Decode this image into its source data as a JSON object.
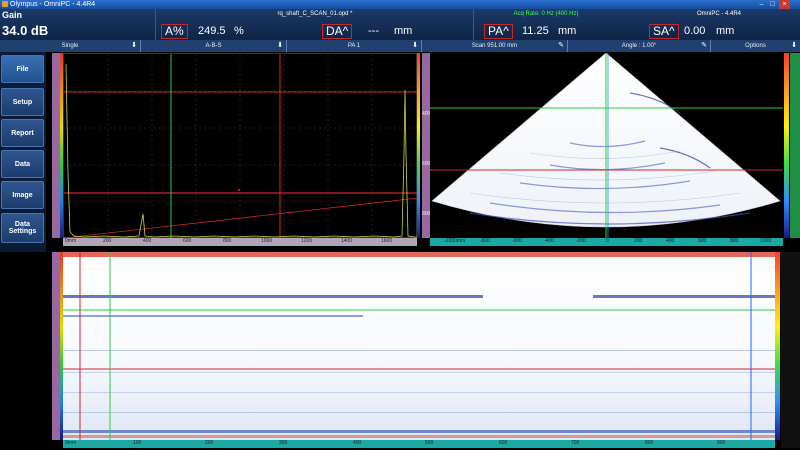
{
  "window": {
    "title": "Olympus - OmniPC - 4.4R4"
  },
  "header": {
    "gain_label": "Gain",
    "gain_value": "34.0 dB",
    "file_name": "rq_shaft_C_SCAN_01.opd *",
    "acq_rate": "Acq Rate: 0 Hz (400 Hz)",
    "app_version": "OmniPC - 4.4R4",
    "readings": [
      {
        "label": "A%",
        "value": "249.5",
        "unit": "%"
      },
      {
        "label": "DA^",
        "value": "---",
        "unit": "mm"
      },
      {
        "label": "PA^",
        "value": "11.25",
        "unit": "mm"
      },
      {
        "label": "SA^",
        "value": "0.00",
        "unit": "mm"
      }
    ]
  },
  "toolbar": {
    "segments": [
      "Single",
      "A-B-S",
      "PA 1",
      "Scan 951.00 mm",
      "Angle : 1.00°",
      "Options"
    ]
  },
  "nav": {
    "items": [
      "File",
      "Setup",
      "Report",
      "Data",
      "Image",
      "Data Settings"
    ]
  },
  "ascan": {
    "x_ticks": [
      "0mm",
      "200",
      "400",
      "600",
      "800",
      "1000",
      "1200",
      "1400",
      "1600"
    ]
  },
  "sscan": {
    "x_ticks": [
      "-1000mm",
      "-800",
      "-600",
      "-400",
      "-200",
      "0",
      "200",
      "400",
      "600",
      "800",
      "1000"
    ],
    "y_ticks": [
      "400",
      "600",
      "800",
      "1000"
    ]
  },
  "cscan": {
    "x_ticks": [
      "0mm",
      "100",
      "200",
      "300",
      "400",
      "500",
      "600",
      "700",
      "800",
      "900"
    ]
  },
  "colors": {
    "accent_red": "#c0282e",
    "cursor_green": "#2ecc40",
    "header_bg": "#17325c"
  }
}
